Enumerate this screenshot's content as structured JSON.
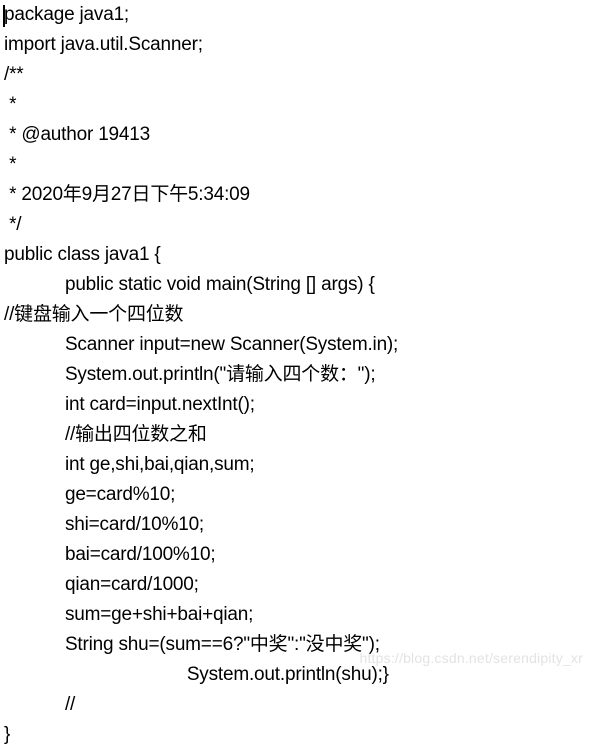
{
  "editor": {
    "background_color": "#ffffff",
    "text_color": "#000000",
    "caret_visible": true,
    "lines": [
      "package java1;",
      "import java.util.Scanner;",
      "/**",
      " * ",
      " * @author 19413",
      " * ",
      " * 2020年9月27日下午5:34:09",
      " */",
      "public class java1 {",
      "            public static void main(String [] args) {",
      "//键盘输入一个四位数",
      "            Scanner input=new Scanner(System.in);",
      "            System.out.println(\"请输入四个数：\");",
      "            int card=input.nextInt();",
      "            //输出四位数之和",
      "            int ge,shi,bai,qian,sum;",
      "            ge=card%10;",
      "            shi=card/10%10;",
      "            bai=card/100%10;",
      "            qian=card/1000;",
      "            sum=ge+shi+bai+qian;",
      "            String shu=(sum==6?\"中奖\":\"没中奖\");",
      "                                    System.out.println(shu);}",
      "            //",
      "}"
    ]
  },
  "watermark": {
    "text": "https://blog.csdn.net/serendipity_xr",
    "color": "#e3e3e3"
  }
}
